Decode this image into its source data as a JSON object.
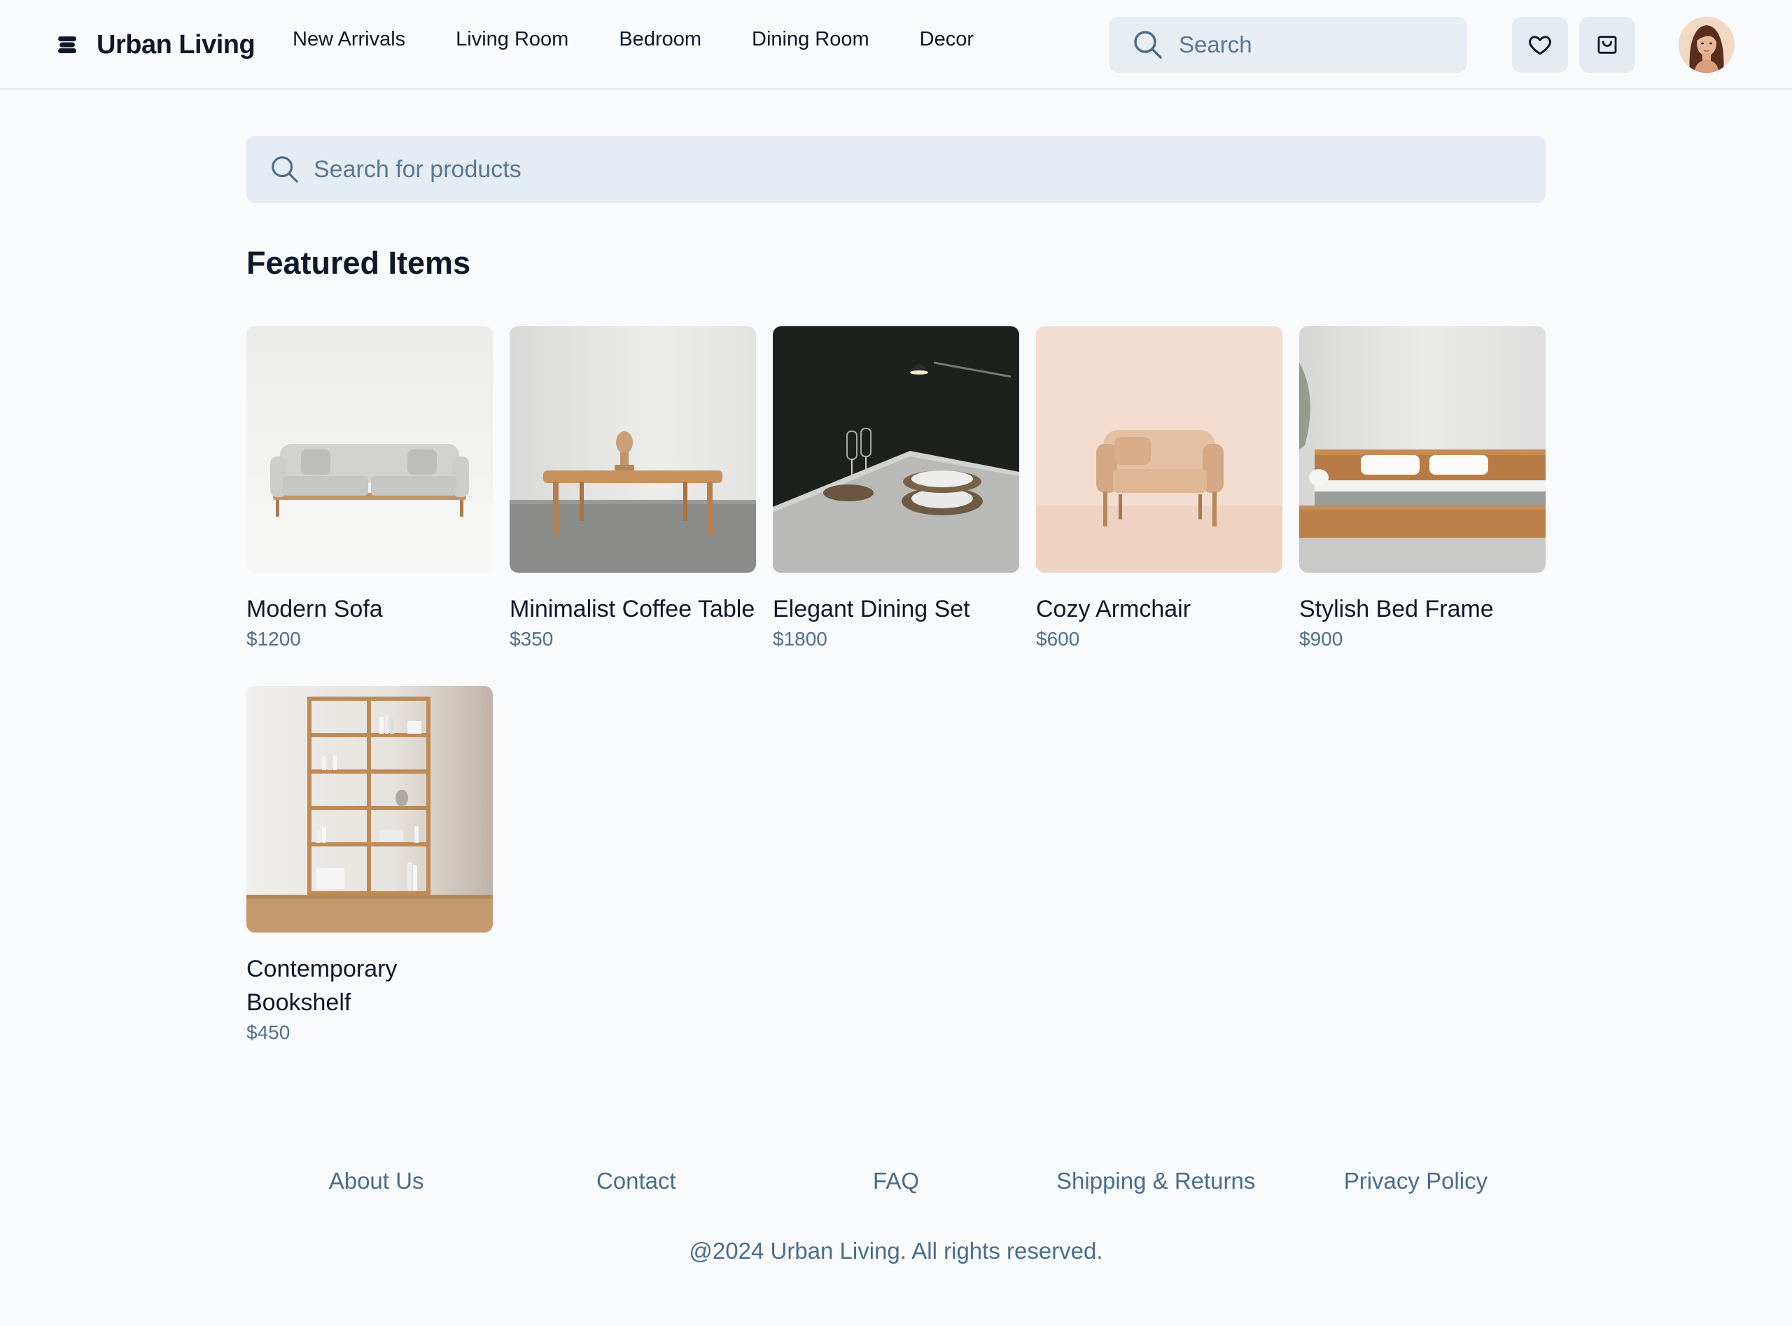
{
  "header": {
    "brand_name": "Urban Living",
    "nav": [
      "New Arrivals",
      "Living Room",
      "Bedroom",
      "Dining Room",
      "Decor"
    ],
    "search_placeholder": "Search",
    "icons": {
      "search": "search-icon",
      "wishlist": "heart-icon",
      "cart": "cart-icon",
      "logo": "stack-logo-icon"
    }
  },
  "main": {
    "search_placeholder": "Search for products",
    "section_title": "Featured Items",
    "products": [
      {
        "name": "Modern Sofa",
        "price": "$1200"
      },
      {
        "name": "Minimalist Coffee Table",
        "price": "$350"
      },
      {
        "name": "Elegant Dining Set",
        "price": "$1800"
      },
      {
        "name": "Cozy Armchair",
        "price": "$600"
      },
      {
        "name": "Stylish Bed Frame",
        "price": "$900"
      },
      {
        "name": "Contemporary Bookshelf",
        "price": "$450"
      }
    ]
  },
  "footer": {
    "links": [
      "About Us",
      "Contact",
      "FAQ",
      "Shipping & Returns",
      "Privacy Policy"
    ],
    "copyright": "@2024 Urban Living. All rights reserved."
  },
  "colors": {
    "background": "#f8fafc",
    "search_bg": "#e6ecf3",
    "muted_text": "#4f7190",
    "primary_text": "#0f172a"
  }
}
